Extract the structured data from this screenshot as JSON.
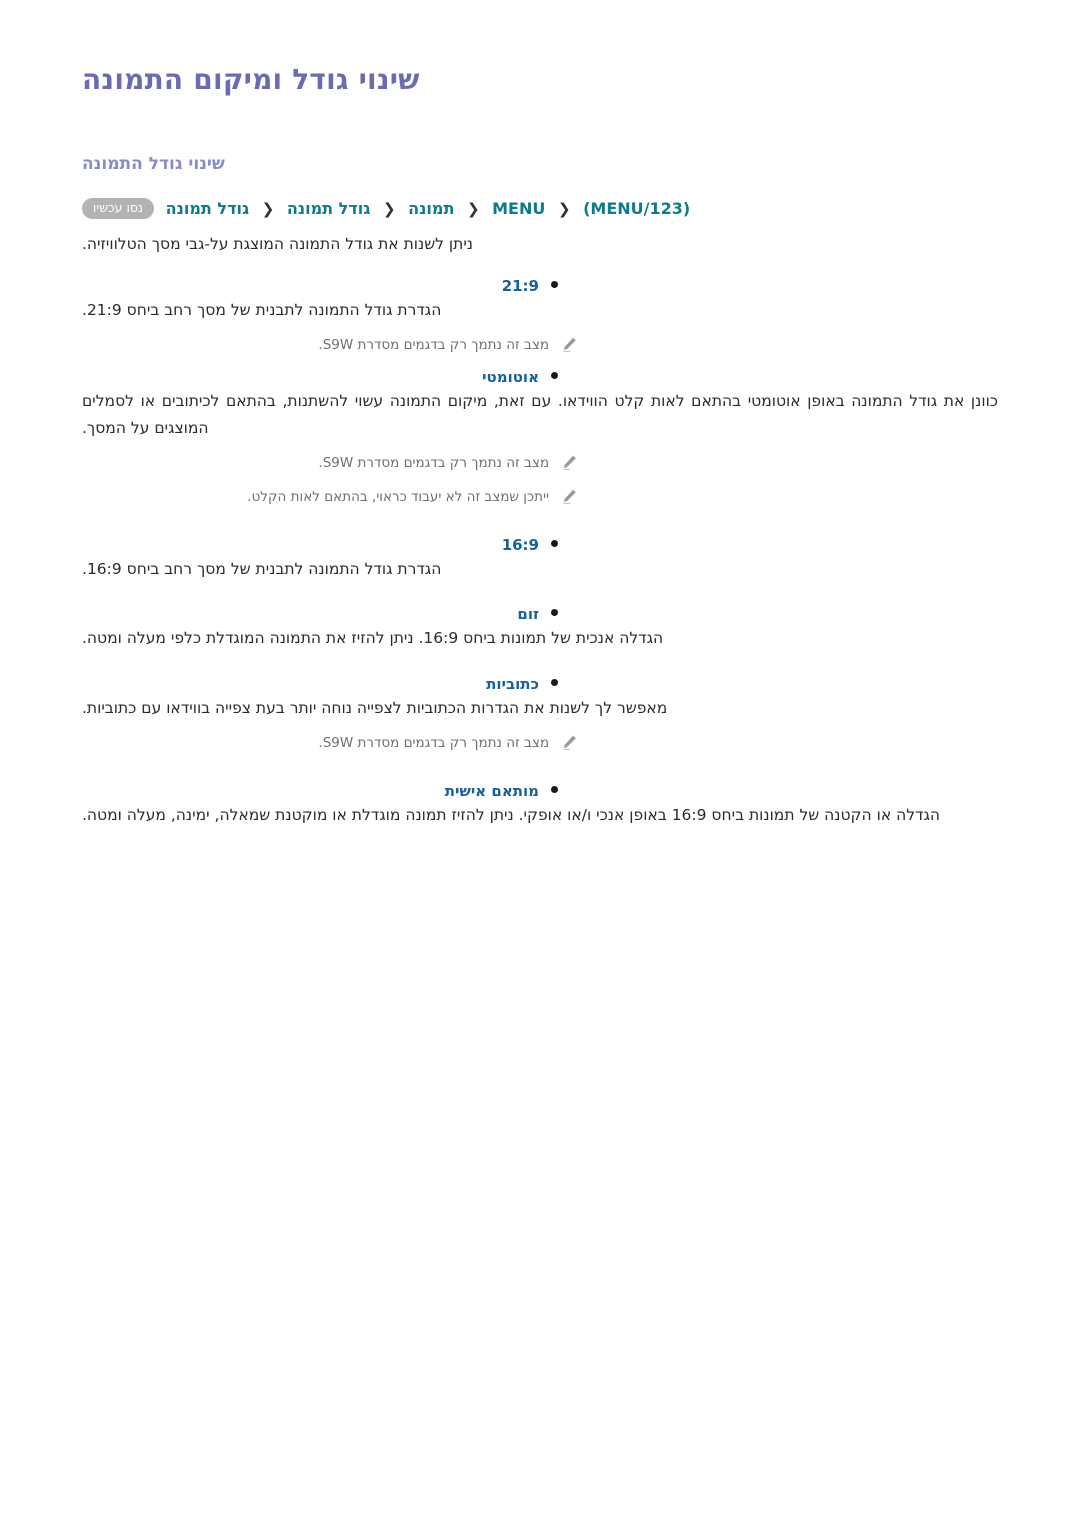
{
  "document": {
    "title": "שינוי גודל ומיקום התמונה",
    "section_title": "שינוי גודל התמונה"
  },
  "breadcrumb": {
    "items": [
      "(MENU/123)",
      "MENU",
      "תמונה",
      "גודל תמונה",
      "גודל תמונה"
    ],
    "separator": "❮",
    "badge": "נסו עכשיו"
  },
  "intro": {
    "text": "ניתן לשנות את גודל התמונה המוצגת על-גבי מסך הטלוויזיה."
  },
  "options": [
    {
      "label": "21:9",
      "description": "הגדרת גודל התמונה לתבנית של מסך רחב ביחס 21:9.",
      "notes": [
        "מצב זה נתמך רק בדגמים מסדרת S9W."
      ]
    },
    {
      "label": "אוטומטי",
      "description": "כוונן את גודל התמונה באופן אוטומטי בהתאם לאות קלט הווידאו. עם זאת, מיקום התמונה עשוי להשתנות, בהתאם לכיתובים או לסמלים המוצגים על המסך.",
      "notes": [
        "מצב זה נתמך רק בדגמים מסדרת S9W.",
        "ייתכן שמצב זה לא יעבוד כראוי, בהתאם לאות הקלט."
      ]
    },
    {
      "label": "16:9",
      "description": "הגדרת גודל התמונה לתבנית של מסך רחב ביחס 16:9.",
      "notes": []
    },
    {
      "label": "זום",
      "description": "הגדלה אנכית של תמונות ביחס 16:9. ניתן להזיז את התמונה המוגדלת כלפי מעלה ומטה.",
      "notes": []
    },
    {
      "label": "כתוביות",
      "description": "מאפשר לך לשנות את הגדרות הכתוביות לצפייה נוחה יותר בעת צפייה בווידאו עם כתוביות.",
      "notes": [
        "מצב זה נתמך רק בדגמים מסדרת S9W."
      ]
    },
    {
      "label": "מותאם אישית",
      "description": "הגדלה או הקטנה של תמונות ביחס 16:9 באופן אנכי ו/או אופקי. ניתן להזיז תמונה מוגדלת או מוקטנת שמאלה, ימינה, מעלה ומטה.",
      "notes": []
    }
  ],
  "icons": {
    "note": "pencil-icon"
  },
  "colors": {
    "title": "#6b6bb0",
    "section_title": "#8b8bc4",
    "breadcrumb": "#0f7b8a",
    "option_label": "#16609e",
    "badge_bg": "#b3b3b3",
    "note_text": "#6f6f6f",
    "body_text": "#2b2b2b"
  }
}
